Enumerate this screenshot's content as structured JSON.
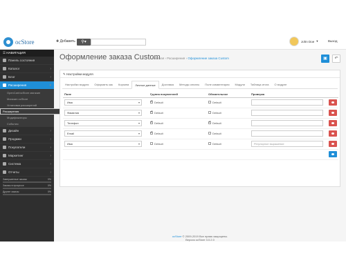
{
  "header": {
    "logo_text": "ocStore",
    "add_label": "Добавить",
    "user_name": "John Doe",
    "logout_label": "Выход"
  },
  "sidebar": {
    "title": "НАВИГАЦИЯ",
    "items": [
      {
        "label": "Панель состояния"
      },
      {
        "label": "Каталог"
      },
      {
        "label": "Блог"
      },
      {
        "label": "Расширения"
      },
      {
        "label": "Дизайн"
      },
      {
        "label": "Продажи"
      },
      {
        "label": "Покупатели"
      },
      {
        "label": "Маркетинг"
      },
      {
        "label": "Система"
      },
      {
        "label": "Отчеты"
      }
    ],
    "sub_items": [
      "OpenCart/ocStore магазин",
      "Магазин ocStore",
      "Установка расширений",
      "Расширения",
      "Модификаторы",
      "События"
    ],
    "stats": [
      {
        "label": "Завершенные заказы",
        "value": "0%"
      },
      {
        "label": "Заказы в процессе",
        "value": "0%"
      },
      {
        "label": "Другие заказы",
        "value": "0%"
      }
    ]
  },
  "main": {
    "title": "Оформление заказа Custom",
    "breadcrumbs": [
      "Главная",
      "Расширения",
      "Оформление заказа Custom"
    ],
    "panel_title": "Настройки модуля",
    "tabs": [
      "Настройки модуля",
      "Оформить как",
      "Корзина",
      "Личные данные",
      "Доставка",
      "Методы оплаты",
      "Поле комментария",
      "Модули",
      "Таблица итога",
      "О модуле"
    ],
    "columns": [
      "Поле",
      "Группа покупателей",
      "Обязательное",
      "Проверка"
    ],
    "rows": [
      {
        "field": "Имя",
        "group": "Default",
        "group_checked": true,
        "required": "Default",
        "required_checked": false,
        "check": ""
      },
      {
        "field": "Фамилия",
        "group": "Default",
        "group_checked": true,
        "required": "Default",
        "required_checked": false,
        "check": ""
      },
      {
        "field": "Телефон",
        "group": "Default",
        "group_checked": true,
        "required": "Default",
        "required_checked": true,
        "check": ""
      },
      {
        "field": "Email",
        "group": "Default",
        "group_checked": true,
        "required": "Default",
        "required_checked": false,
        "check": ""
      },
      {
        "field": "Имя",
        "group": "Default",
        "group_checked": false,
        "required": "Default",
        "required_checked": false,
        "check": "Регулярное выражение"
      }
    ]
  },
  "footer": {
    "brand": "ocStore",
    "line1": "© 2009-2019 Все права защищены.",
    "line2": "Версия ocStore 3.0.2.0"
  },
  "colors": {
    "accent": "#1f8fd8",
    "danger": "#d9534f",
    "sidebar": "#2f2f2f"
  }
}
